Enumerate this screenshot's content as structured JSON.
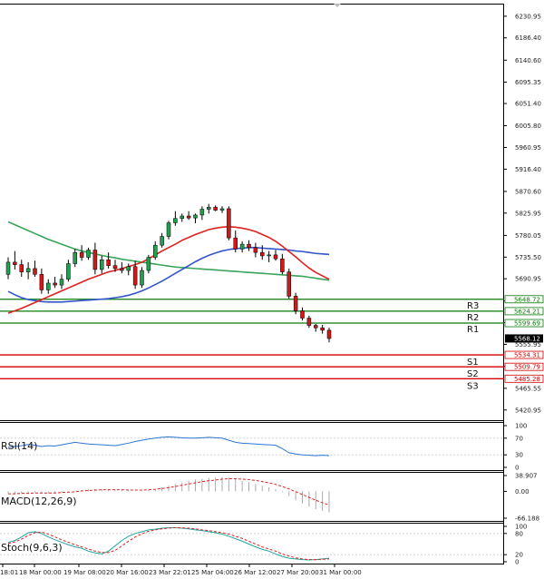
{
  "chart_data": {
    "type": "candlestick",
    "price_axis": {
      "ticks": [
        "6230.95",
        "6186.40",
        "6140.60",
        "6095.35",
        "6051.40",
        "6005.80",
        "5960.95",
        "5916.40",
        "5870.60",
        "5825.95",
        "5780.05",
        "5735.50",
        "5690.95",
        "5645.10",
        "5600.55",
        "5555.95",
        "5510.50",
        "5465.55",
        "5420.95"
      ],
      "range": [
        5400,
        6255
      ]
    },
    "x_labels": [
      "18:01",
      "18 Mar 00:00",
      "19 Mar 08:00",
      "20 Mar 16:00",
      "23 Mar 22:01",
      "25 Mar 04:00",
      "26 Mar 12:00",
      "27 Mar 20:00",
      "31 Mar 00:00"
    ],
    "candles": [
      [
        5700,
        5735,
        5690,
        5725
      ],
      [
        5725,
        5748,
        5710,
        5720
      ],
      [
        5720,
        5730,
        5695,
        5705
      ],
      [
        5705,
        5725,
        5690,
        5712
      ],
      [
        5712,
        5728,
        5695,
        5700
      ],
      [
        5700,
        5712,
        5660,
        5668
      ],
      [
        5668,
        5690,
        5660,
        5682
      ],
      [
        5682,
        5695,
        5672,
        5678
      ],
      [
        5678,
        5700,
        5670,
        5690
      ],
      [
        5690,
        5730,
        5685,
        5722
      ],
      [
        5722,
        5752,
        5715,
        5745
      ],
      [
        5745,
        5760,
        5728,
        5735
      ],
      [
        5735,
        5755,
        5730,
        5750
      ],
      [
        5750,
        5765,
        5700,
        5710
      ],
      [
        5710,
        5738,
        5702,
        5730
      ],
      [
        5730,
        5745,
        5712,
        5718
      ],
      [
        5718,
        5730,
        5705,
        5712
      ],
      [
        5712,
        5725,
        5702,
        5708
      ],
      [
        5708,
        5722,
        5698,
        5716
      ],
      [
        5716,
        5728,
        5670,
        5678
      ],
      [
        5678,
        5715,
        5672,
        5708
      ],
      [
        5708,
        5740,
        5702,
        5735
      ],
      [
        5735,
        5768,
        5730,
        5760
      ],
      [
        5760,
        5785,
        5755,
        5778
      ],
      [
        5778,
        5810,
        5772,
        5806
      ],
      [
        5806,
        5830,
        5800,
        5815
      ],
      [
        5815,
        5825,
        5808,
        5820
      ],
      [
        5820,
        5830,
        5812,
        5816
      ],
      [
        5816,
        5825,
        5805,
        5822
      ],
      [
        5822,
        5840,
        5812,
        5834
      ],
      [
        5834,
        5845,
        5825,
        5838
      ],
      [
        5838,
        5842,
        5830,
        5832
      ],
      [
        5832,
        5840,
        5826,
        5835
      ],
      [
        5835,
        5840,
        5770,
        5775
      ],
      [
        5775,
        5790,
        5745,
        5752
      ],
      [
        5752,
        5768,
        5745,
        5762
      ],
      [
        5762,
        5770,
        5748,
        5755
      ],
      [
        5755,
        5765,
        5735,
        5745
      ],
      [
        5745,
        5760,
        5730,
        5738
      ],
      [
        5738,
        5748,
        5725,
        5740
      ],
      [
        5740,
        5750,
        5728,
        5732
      ],
      [
        5732,
        5742,
        5700,
        5705
      ],
      [
        5705,
        5712,
        5650,
        5655
      ],
      [
        5655,
        5662,
        5618,
        5625
      ],
      [
        5625,
        5632,
        5605,
        5610
      ],
      [
        5610,
        5615,
        5590,
        5595
      ],
      [
        5595,
        5598,
        5582,
        5590
      ],
      [
        5590,
        5596,
        5578,
        5585
      ],
      [
        5585,
        5590,
        5560,
        5568
      ]
    ],
    "ma_red": [
      5620,
      5625,
      5630,
      5636,
      5642,
      5648,
      5654,
      5660,
      5666,
      5672,
      5678,
      5684,
      5690,
      5695,
      5700,
      5705,
      5708,
      5712,
      5716,
      5720,
      5725,
      5732,
      5740,
      5748,
      5755,
      5762,
      5770,
      5776,
      5782,
      5787,
      5792,
      5795,
      5797,
      5798,
      5797,
      5795,
      5792,
      5788,
      5782,
      5776,
      5768,
      5758,
      5747,
      5736,
      5724,
      5713,
      5704,
      5697,
      5690
    ],
    "ma_blue": [
      5665,
      5658,
      5652,
      5648,
      5646,
      5644,
      5643,
      5643,
      5643,
      5644,
      5645,
      5646,
      5647,
      5648,
      5649,
      5650,
      5652,
      5654,
      5657,
      5661,
      5666,
      5672,
      5679,
      5686,
      5694,
      5702,
      5710,
      5718,
      5726,
      5733,
      5739,
      5744,
      5748,
      5751,
      5753,
      5754,
      5755,
      5755,
      5754,
      5753,
      5752,
      5751,
      5750,
      5748,
      5747,
      5745,
      5743,
      5742,
      5741
    ],
    "ma_green": [
      5808,
      5802,
      5796,
      5790,
      5784,
      5778,
      5772,
      5767,
      5762,
      5757,
      5752,
      5748,
      5745,
      5742,
      5739,
      5736,
      5734,
      5731,
      5729,
      5727,
      5725,
      5723,
      5721,
      5719,
      5717,
      5715,
      5714,
      5713,
      5712,
      5711,
      5710,
      5709,
      5708,
      5707,
      5706,
      5705,
      5704,
      5703,
      5702,
      5701,
      5700,
      5699,
      5698,
      5697,
      5696,
      5694,
      5692,
      5690,
      5688
    ],
    "levels": {
      "R3": 5648.72,
      "R2": 5624.21,
      "R1": 5599.69,
      "S1": 5534.31,
      "S2": 5509.79,
      "S3": 5485.28,
      "current": 5568.12
    },
    "level_labels": [
      "R3",
      "R2",
      "R1",
      "S1",
      "S2",
      "S3"
    ],
    "level_tags": [
      "5648.72",
      "5624.21",
      "5599.69",
      "5534.31",
      "5509.79",
      "5485.28"
    ],
    "current_tag": "5568.12",
    "rsi": {
      "label": "RSI(14)",
      "ticks": [
        "100",
        "70",
        "30",
        "0"
      ],
      "values": [
        48,
        50,
        52,
        55,
        53,
        50,
        52,
        51,
        54,
        57,
        60,
        58,
        56,
        55,
        54,
        53,
        52,
        55,
        58,
        62,
        65,
        68,
        70,
        72,
        73,
        72,
        71,
        70,
        70,
        71,
        72,
        71,
        70,
        65,
        60,
        58,
        57,
        56,
        55,
        54,
        53,
        45,
        35,
        32,
        30,
        29,
        28,
        29,
        28
      ]
    },
    "macd": {
      "label": "MACD(12,26,9)",
      "ticks": [
        "38.907",
        "0.00",
        "-66.188"
      ],
      "hist": [
        -5,
        -6,
        -5,
        -4,
        -3,
        -5,
        -6,
        -5,
        -4,
        -2,
        1,
        3,
        5,
        6,
        5,
        4,
        4,
        3,
        2,
        0,
        1,
        3,
        6,
        10,
        14,
        18,
        22,
        26,
        29,
        31,
        33,
        34,
        35,
        34,
        30,
        26,
        22,
        18,
        14,
        10,
        5,
        -2,
        -12,
        -22,
        -30,
        -38,
        -44,
        -48,
        -52
      ],
      "signal": [
        -6,
        -6,
        -5,
        -5,
        -4,
        -4,
        -4,
        -4,
        -3,
        -2,
        -1,
        1,
        2,
        3,
        4,
        4,
        4,
        4,
        3,
        3,
        3,
        4,
        5,
        7,
        9,
        12,
        15,
        18,
        21,
        24,
        26,
        28,
        30,
        31,
        31,
        30,
        29,
        27,
        24,
        21,
        17,
        12,
        6,
        -1,
        -8,
        -15,
        -22,
        -28,
        -34
      ]
    },
    "stoch": {
      "label": "Stoch(9,6,3)",
      "ticks": [
        "100",
        "80",
        "20",
        "0"
      ],
      "k": [
        55,
        60,
        70,
        82,
        85,
        80,
        70,
        62,
        55,
        48,
        42,
        38,
        30,
        25,
        22,
        30,
        45,
        60,
        72,
        80,
        85,
        90,
        92,
        95,
        96,
        96,
        95,
        93,
        90,
        88,
        85,
        82,
        78,
        72,
        65,
        58,
        50,
        42,
        35,
        30,
        22,
        15,
        10,
        8,
        6,
        5,
        6,
        8,
        10
      ],
      "d": [
        52,
        56,
        64,
        74,
        82,
        84,
        78,
        70,
        62,
        55,
        48,
        42,
        36,
        30,
        26,
        26,
        32,
        45,
        58,
        70,
        79,
        86,
        90,
        93,
        95,
        96,
        96,
        95,
        93,
        90,
        88,
        85,
        82,
        78,
        72,
        66,
        58,
        50,
        42,
        36,
        30,
        22,
        16,
        11,
        8,
        6,
        6,
        7,
        8
      ]
    }
  }
}
